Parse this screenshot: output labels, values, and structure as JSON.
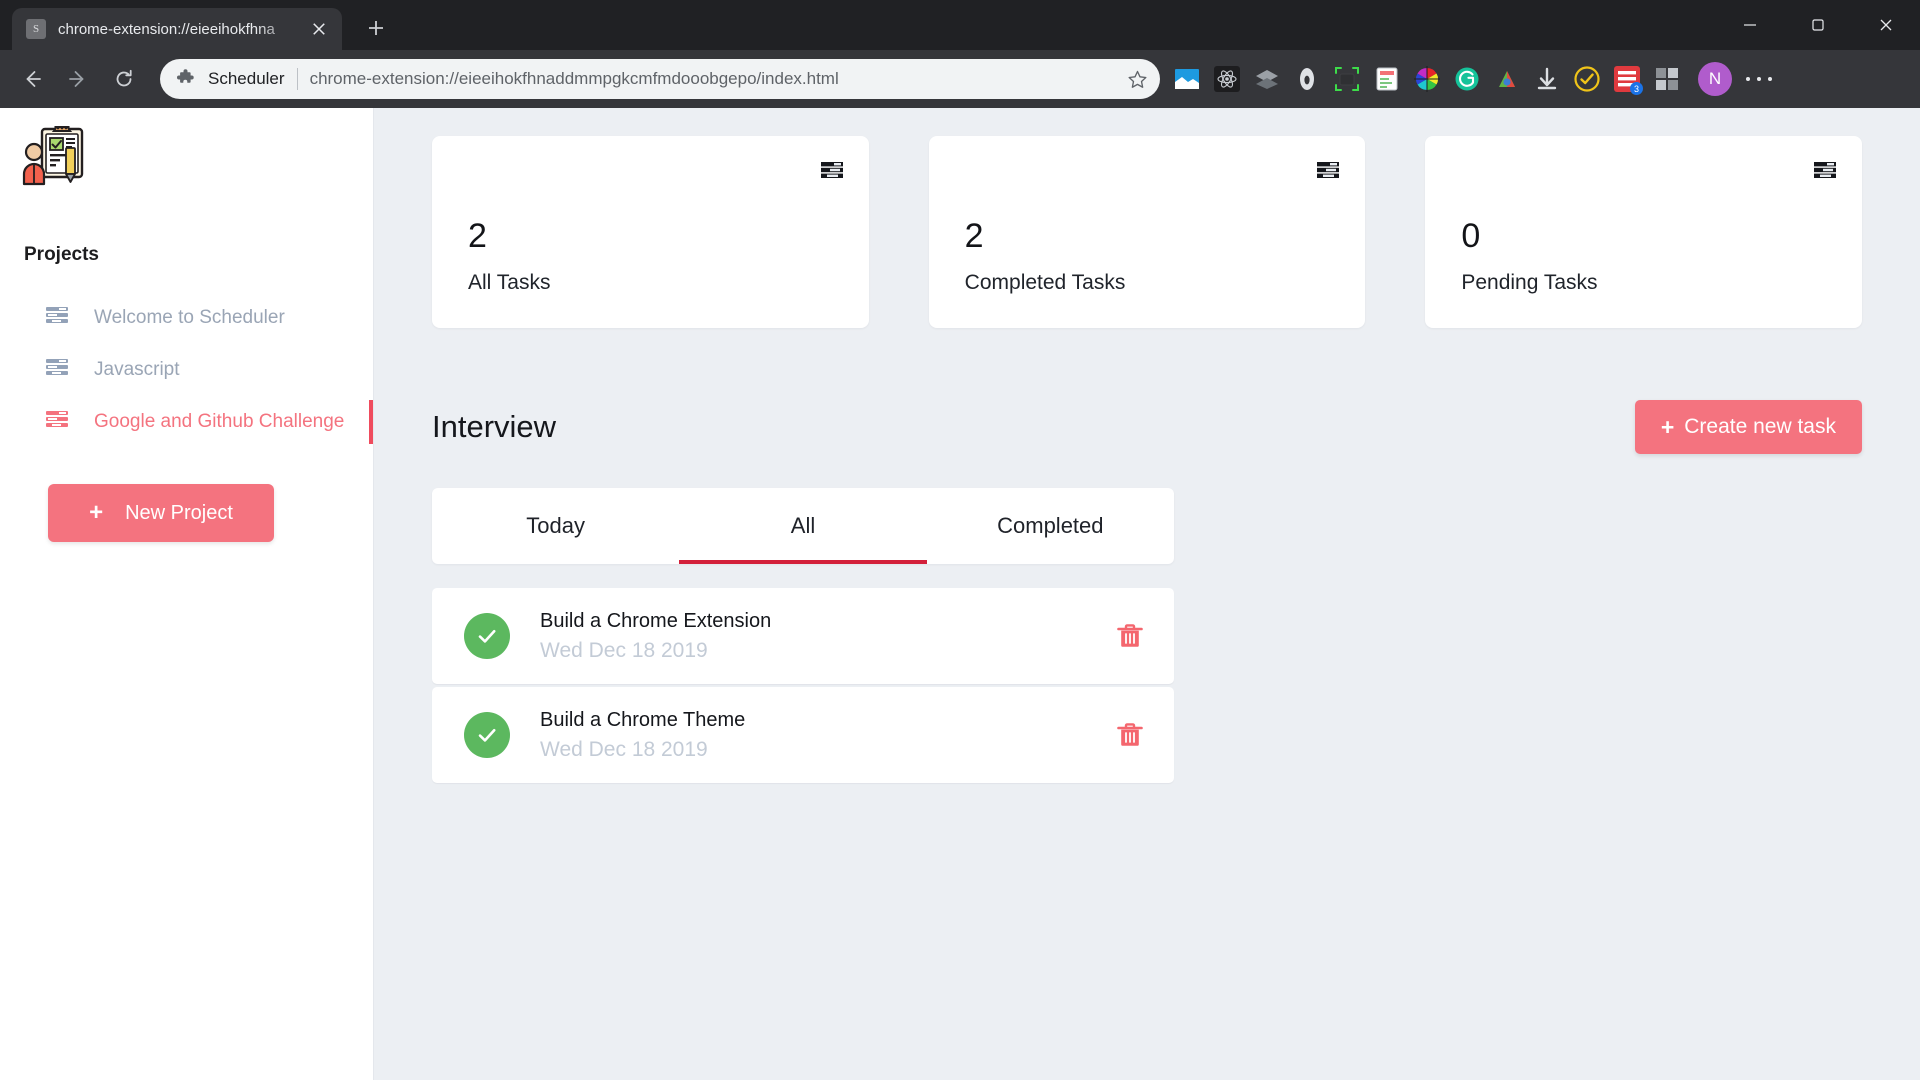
{
  "browser": {
    "tab": {
      "favicon_letter": "S",
      "title": "chrome-extension://eieeihokfhna"
    },
    "new_tab_label": "New tab",
    "window_controls": {
      "minimize": "Minimize",
      "maximize": "Maximize",
      "close": "Close"
    },
    "nav": {
      "back": "Back",
      "forward": "Forward",
      "reload": "Reload"
    },
    "omnibox": {
      "extension_name": "Scheduler",
      "url": "chrome-extension://eieeihokfhnaddmmpgkcmfmdooobgepo/index.html",
      "bookmark": "Bookmark this tab"
    },
    "extensions": [
      {
        "name": "window-capture-icon",
        "badge": ""
      },
      {
        "name": "react-devtools-icon",
        "badge": ""
      },
      {
        "name": "layers-icon",
        "badge": ""
      },
      {
        "name": "wave-evaluation-icon",
        "badge": ""
      },
      {
        "name": "screenshot-region-icon",
        "badge": ""
      },
      {
        "name": "notes-icon",
        "badge": ""
      },
      {
        "name": "color-picker-icon",
        "badge": ""
      },
      {
        "name": "grammarly-icon",
        "badge": ""
      },
      {
        "name": "colorzilla-icon",
        "badge": ""
      },
      {
        "name": "download-icon",
        "badge": ""
      },
      {
        "name": "todoist-icon",
        "badge": ""
      },
      {
        "name": "feedly-icon",
        "badge": "3"
      },
      {
        "name": "puzzle-extension-icon",
        "badge": ""
      }
    ],
    "profile_initial": "N",
    "menu_label": "Customize and control Google Chrome"
  },
  "sidebar": {
    "logo_name": "scheduler-clipboard-logo",
    "heading": "Projects",
    "projects": [
      {
        "label": "Welcome to Scheduler",
        "active": false
      },
      {
        "label": "Javascript",
        "active": false
      },
      {
        "label": "Google and Github Challenge",
        "active": true
      }
    ],
    "new_project": {
      "icon": "+",
      "label": "New Project"
    }
  },
  "main": {
    "stats": [
      {
        "value": "2",
        "label": "All Tasks",
        "icon": "list-icon"
      },
      {
        "value": "2",
        "label": "Completed Tasks",
        "icon": "list-icon"
      },
      {
        "value": "0",
        "label": "Pending Tasks",
        "icon": "list-icon"
      }
    ],
    "section_title": "Interview",
    "create_task": {
      "icon": "+",
      "label": "Create new task"
    },
    "tabs": [
      {
        "label": "Today",
        "active": false
      },
      {
        "label": "All",
        "active": true
      },
      {
        "label": "Completed",
        "active": false
      }
    ],
    "tasks": [
      {
        "name": "Build a Chrome Extension",
        "date": "Wed Dec 18 2019",
        "completed": true,
        "delete_label": "Delete task"
      },
      {
        "name": "Build a Chrome Theme",
        "date": "Wed Dec 18 2019",
        "completed": true,
        "delete_label": "Delete task"
      }
    ]
  },
  "colors": {
    "accent_pink": "#f4737f",
    "accent_red": "#d3203a",
    "success_green": "#5cb85f",
    "page_bg": "#eceff3",
    "muted_text": "#9aa5b5"
  }
}
